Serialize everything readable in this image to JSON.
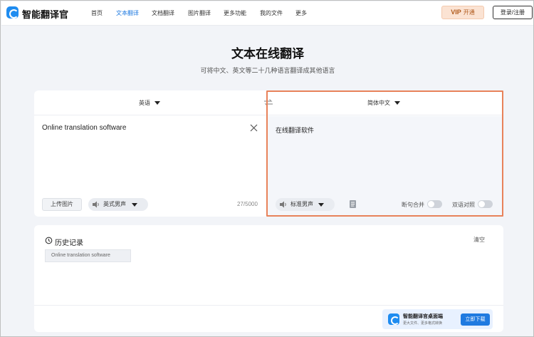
{
  "nav": {
    "logo_text": "智能翻译官",
    "items": [
      {
        "label": "首页",
        "active": false
      },
      {
        "label": "文本翻译",
        "active": true
      },
      {
        "label": "文档翻译",
        "active": false
      },
      {
        "label": "图片翻译",
        "active": false
      },
      {
        "label": "更多功能",
        "active": false
      },
      {
        "label": "我的文件",
        "active": false
      },
      {
        "label": "更多",
        "active": false
      }
    ],
    "vip_label": "VIP",
    "vip_action": "开通",
    "login_label": "登录/注册"
  },
  "hero": {
    "title": "文本在线翻译",
    "subtitle": "可将中文、英文等二十几种语言翻译成其他语言"
  },
  "translator": {
    "source_language": "英语",
    "target_language": "简体中文",
    "source_text": "Online translation software",
    "target_text": "在线翻译软件",
    "upload_label": "上传图片",
    "source_voice": "英式男声",
    "target_voice": "标准男声",
    "char_count": "27/5000",
    "toggle_sentence_merge": "断句合并",
    "toggle_bilingual": "双语对照"
  },
  "history": {
    "title": "历史记录",
    "clear_label": "清空",
    "items": [
      "Online translation software"
    ]
  },
  "download": {
    "title": "智能翻译官桌面端",
    "subtitle": "更大文件、更多格式转换",
    "button": "立即下载"
  },
  "colors": {
    "accent": "#1f7ae0",
    "highlight_border": "#e8825a",
    "vip_bg": "#fbe3d3"
  }
}
